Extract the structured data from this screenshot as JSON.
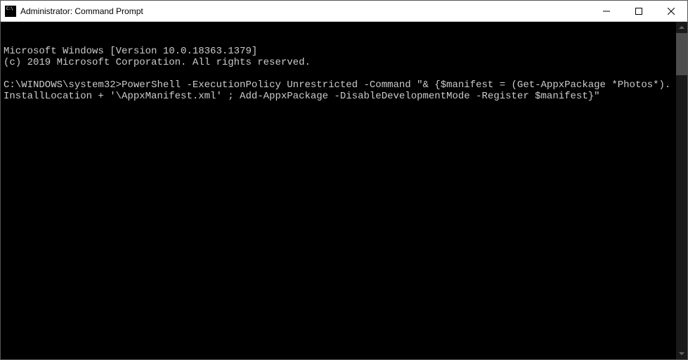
{
  "window": {
    "title": "Administrator: Command Prompt",
    "icon_label": "C:\\"
  },
  "terminal": {
    "line1": "Microsoft Windows [Version 10.0.18363.1379]",
    "line2": "(c) 2019 Microsoft Corporation. All rights reserved.",
    "blank": "",
    "prompt": "C:\\WINDOWS\\system32>",
    "command": "PowerShell -ExecutionPolicy Unrestricted -Command \"& {$manifest = (Get-AppxPackage *Photos*).InstallLocation + '\\AppxManifest.xml' ; Add-AppxPackage -DisableDevelopmentMode -Register $manifest}\""
  }
}
